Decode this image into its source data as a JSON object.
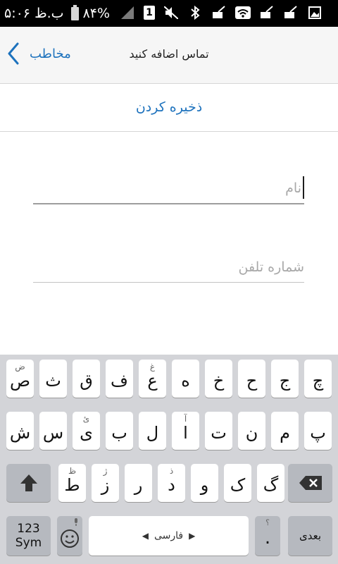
{
  "status_bar": {
    "time": "۵:۰۶ ب.ظ",
    "battery": "۸۴%",
    "sim": "1"
  },
  "navbar": {
    "back_label": "مخاطب",
    "title": "تماس اضافه کنید"
  },
  "save": {
    "label": "ذخیره کردن"
  },
  "form": {
    "name_placeholder": "نام",
    "phone_placeholder": "شماره تلفن"
  },
  "keyboard": {
    "row1": [
      {
        "main": "ص",
        "hint": "ض"
      },
      {
        "main": "ث",
        "hint": ""
      },
      {
        "main": "ق",
        "hint": ""
      },
      {
        "main": "ف",
        "hint": ""
      },
      {
        "main": "ع",
        "hint": "غ"
      },
      {
        "main": "ه",
        "hint": ""
      },
      {
        "main": "خ",
        "hint": ""
      },
      {
        "main": "ح",
        "hint": ""
      },
      {
        "main": "ج",
        "hint": ""
      },
      {
        "main": "چ",
        "hint": ""
      }
    ],
    "row2": [
      {
        "main": "ش",
        "hint": ""
      },
      {
        "main": "س",
        "hint": ""
      },
      {
        "main": "ی",
        "hint": "ئ"
      },
      {
        "main": "ب",
        "hint": ""
      },
      {
        "main": "ل",
        "hint": ""
      },
      {
        "main": "ا",
        "hint": "آ"
      },
      {
        "main": "ت",
        "hint": ""
      },
      {
        "main": "ن",
        "hint": ""
      },
      {
        "main": "م",
        "hint": ""
      },
      {
        "main": "پ",
        "hint": ""
      }
    ],
    "row3": [
      {
        "main": "ط",
        "hint": "ظ"
      },
      {
        "main": "ز",
        "hint": "ژ"
      },
      {
        "main": "ر",
        "hint": ""
      },
      {
        "main": "د",
        "hint": "ذ"
      },
      {
        "main": "و",
        "hint": ""
      },
      {
        "main": "ک",
        "hint": ""
      },
      {
        "main": "گ",
        "hint": ""
      }
    ],
    "sym_top": "123",
    "sym_bottom": "Sym",
    "space_label": "فارسی",
    "dot_label": ".",
    "dot_hint": "؟",
    "next_label": "بعدی"
  },
  "colors": {
    "accent": "#1d72bd",
    "keyboard_bg": "#d3d4d8",
    "key_bg": "#ffffff",
    "key_gray": "#b6b9bf"
  }
}
